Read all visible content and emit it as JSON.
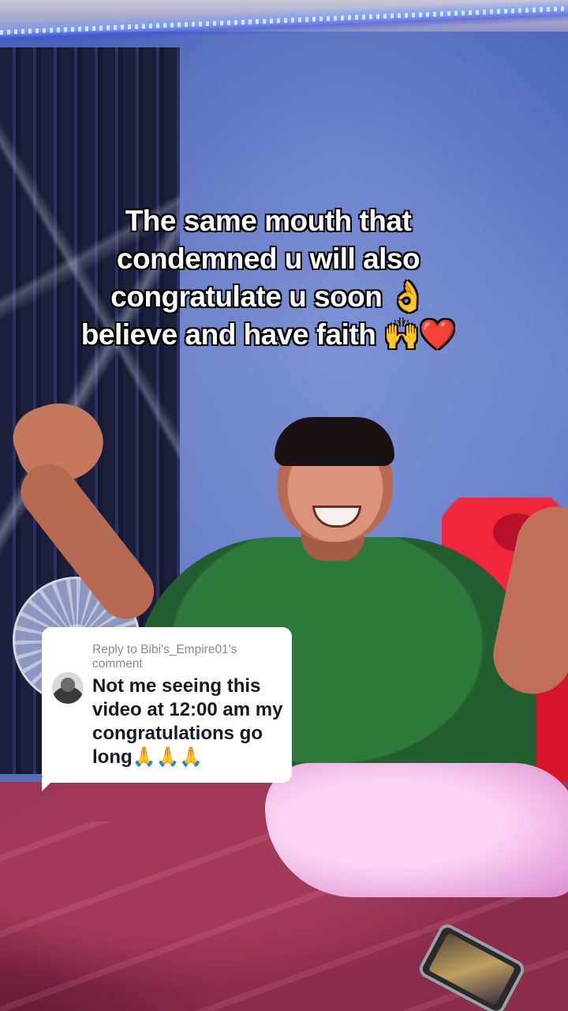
{
  "caption": {
    "lines": [
      "The same mouth that",
      "condemned u will also",
      "congratulate u soon 👌",
      "believe and have faith 🙌❤️"
    ]
  },
  "reply_comment": {
    "header_line1": "Reply to Bibi's_Empire01's",
    "header_line2": "comment",
    "text": "Not me seeing this video at 12:00 am my congratulations go long🙏🙏🙏",
    "avatar_icon": "user-avatar-icon"
  },
  "colors": {
    "caption_text": "#ffffff",
    "caption_stroke": "#000000",
    "bubble_background": "#ffffff",
    "reply_header": "#8a8a8a",
    "reply_text": "#161823"
  }
}
